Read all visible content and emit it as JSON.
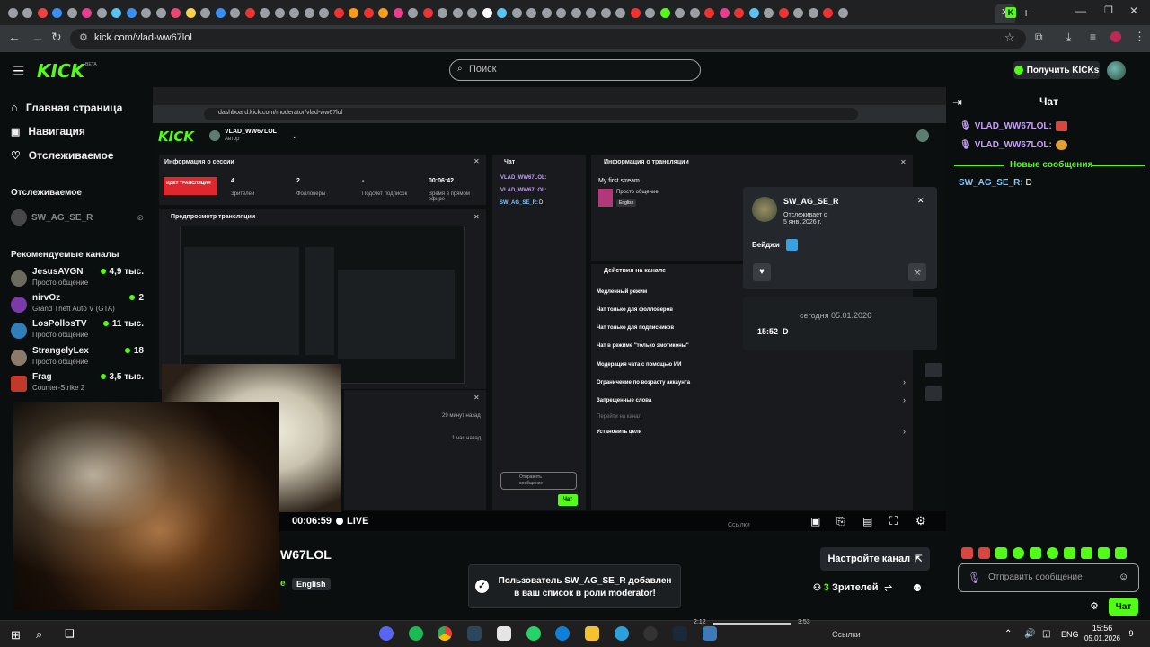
{
  "browser": {
    "url": "kick.com/vlad-ww67lol",
    "tab_colors": [
      "#9aa0a6",
      "#9aa0a6",
      "#ec4444",
      "#3b8ff0",
      "#9aa0a6",
      "#e83e8c",
      "#9aa0a6",
      "#5cc2f0",
      "#3b8ff0",
      "#9aa0a6",
      "#9aa0a6",
      "#e9476e",
      "#f9d44a",
      "#9aa0a6",
      "#3b8ff0",
      "#9aa0a6",
      "#e33",
      "#9aa0a6",
      "#9aa0a6",
      "#9aa0a6",
      "#9aa0a6",
      "#9aa0a6",
      "#e33",
      "#f59c1a",
      "#e33",
      "#f59c1a",
      "#e83e8c",
      "#9aa0a6",
      "#e33",
      "#9aa0a6",
      "#9aa0a6",
      "#9aa0a6",
      "#fff",
      "#5cc2f0",
      "#9aa0a6",
      "#9aa0a6",
      "#9aa0a6",
      "#9aa0a6",
      "#9aa0a6",
      "#9aa0a6",
      "#9aa0a6",
      "#9aa0a6",
      "#e33",
      "#9aa0a6",
      "#53fc18",
      "#9aa0a6",
      "#9aa0a6",
      "#e33",
      "#e83e8c",
      "#e33",
      "#5cc2f0",
      "#9aa0a6",
      "#e33",
      "#9aa0a6",
      "#9aa0a6",
      "#e33",
      "#9aa0a6"
    ]
  },
  "header": {
    "logo": "KICK",
    "logo_badge": "BETA",
    "search_placeholder": "Поиск",
    "kicks_button": "Получить KICKs"
  },
  "sidebar": {
    "nav": [
      {
        "label": "Главная страница",
        "icon": "home-icon"
      },
      {
        "label": "Навигация",
        "icon": "compass-icon"
      },
      {
        "label": "Отслеживаемое",
        "icon": "heart-icon"
      }
    ],
    "following_heading": "Отслеживаемое",
    "following": [
      {
        "name": "SW_AG_SE_R"
      }
    ],
    "recommended_heading": "Рекомендуемые каналы",
    "recommended": [
      {
        "name": "JesusAVGN",
        "category": "Просто общение",
        "viewers": "4,9 тыс.",
        "color": "#6b6a5f"
      },
      {
        "name": "nirvOz",
        "category": "Grand Theft Auto V (GTA)",
        "viewers": "2",
        "color": "#7b3aa8"
      },
      {
        "name": "LosPollosTV",
        "category": "Просто общение",
        "viewers": "11 тыс.",
        "color": "#2f7fb8"
      },
      {
        "name": "StrangelyLex",
        "category": "Просто общение",
        "viewers": "18",
        "color": "#8c7a6b"
      },
      {
        "name": "Frag",
        "category": "Counter-Strike 2",
        "viewers": "3,5 тыс.",
        "color": "#c0392b"
      }
    ]
  },
  "inner": {
    "url": "dashboard.kick.com/moderator/vlad-ww67lol",
    "logo": "KICK",
    "user": "VLAD_WW67LOL",
    "role": "Автор",
    "session_title": "Информация о сессии",
    "live_badge": "ИДЕТ ТРАНСЛЯЦИЯ",
    "stats": [
      {
        "value": "4",
        "label": "Зрителей"
      },
      {
        "value": "2",
        "label": "Фолловеры"
      },
      {
        "value": "-",
        "label": "Подсчет подписок"
      },
      {
        "value": "00:06:42",
        "label": "Время в прямом эфире"
      }
    ],
    "preview_title": "Предпросмотр трансляции",
    "chat_title": "Чат",
    "chat_msgs": [
      {
        "user": "VLAD_WW67LOL:"
      },
      {
        "user": "VLAD_WW67LOL:"
      },
      {
        "user": "SW_AG_SE_R:",
        "text": "D"
      }
    ],
    "chat_placeholder": "Отправить сообщение",
    "chat_send": "Чат",
    "stream_info_title": "Информация о трансляции",
    "stream_name": "My first stream.",
    "stream_category": "Просто общение",
    "stream_lang": "English",
    "actions_title": "Действия на канале",
    "actions": [
      "Медленный режим",
      "Чат только для фолловеров",
      "Чат только для подписчиков",
      "Чат в режиме \"только эмотиконы\"",
      "Модерация чата с помощью ИИ",
      "Ограничение по возрасту аккаунта",
      "Запрещенные слова",
      "Перейти на канал",
      "Установить цели"
    ],
    "activity_times": [
      "29 минут назад",
      "1 час назад"
    ],
    "user_card": {
      "name": "SW_AG_SE_R",
      "following_since_label": "Отслеживает с",
      "following_since": "5 янв. 2026 г.",
      "badges_label": "Бейджи",
      "date_sep": "сегодня 05.01.2026",
      "msg_time": "15:52",
      "msg_text": "D"
    }
  },
  "player": {
    "time": "00:06:59",
    "live": "LIVE",
    "links_label": "Ссылки"
  },
  "channel": {
    "title_fragment": "W67LOL",
    "category_fragment": "е",
    "language": "English",
    "config_button": "Настройте канал",
    "viewers_count": "3",
    "viewers_label": "Зрителей"
  },
  "toast": {
    "text": "Пользователь SW_AG_SE_R добавлен в ваш список в роли moderator!"
  },
  "chat": {
    "title": "Чат",
    "messages": [
      {
        "user": "VLAD_WW67LOL:",
        "emote_color": "#d9453f"
      },
      {
        "user": "VLAD_WW67LOL:",
        "emote_color": "#e0a234"
      }
    ],
    "new_messages": "Новые сообщения",
    "new_msg": {
      "user": "SW_AG_SE_R:",
      "text": "D"
    },
    "emotes": [
      "#d9453f",
      "#d9453f",
      "#53fc18",
      "#53fc18",
      "#53fc18",
      "#53fc18",
      "#53fc18",
      "#53fc18",
      "#53fc18",
      "#53fc18"
    ],
    "input_placeholder": "Отправить сообщение",
    "send_button": "Чат"
  },
  "taskbar": {
    "lang": "ENG",
    "time": "15:56",
    "date": "05.01.2026",
    "notif": "9",
    "media_start": "2:12",
    "media_end": "3:53",
    "media_links": "Ссылки"
  }
}
